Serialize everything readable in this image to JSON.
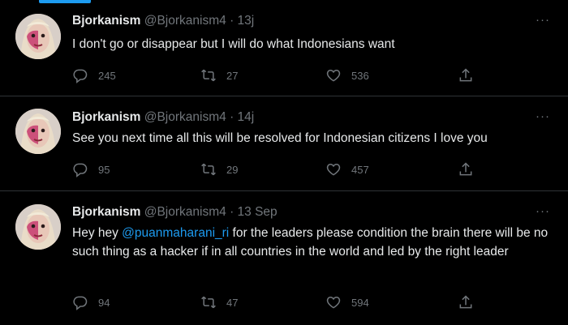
{
  "tweets": [
    {
      "name": "Bjorkanism",
      "handle": "@Bjorkanism4",
      "time": "13j",
      "text_before": "I don't go or disappear but I will do what Indonesians want",
      "mention": "",
      "text_after": "",
      "replies": "245",
      "retweets": "27",
      "likes": "536"
    },
    {
      "name": "Bjorkanism",
      "handle": "@Bjorkanism4",
      "time": "14j",
      "text_before": "See you next time all this will be resolved for Indonesian citizens I love you",
      "mention": "",
      "text_after": "",
      "replies": "95",
      "retweets": "29",
      "likes": "457"
    },
    {
      "name": "Bjorkanism",
      "handle": "@Bjorkanism4",
      "time": "13 Sep",
      "text_before": "Hey hey ",
      "mention": "@puanmaharani_ri",
      "text_after": " for the leaders please condition the brain there will be no such thing as a hacker if in all countries in the world and led by the right leader",
      "replies": "94",
      "retweets": "47",
      "likes": "594"
    }
  ],
  "separator": "·",
  "more_glyph": "···",
  "icons": [
    "reply-icon",
    "retweet-icon",
    "like-icon",
    "share-icon",
    "more-icon"
  ],
  "colors": {
    "background": "#000000",
    "text": "#e7e9ea",
    "muted": "#71767b",
    "accent": "#1d9bf0",
    "border": "#2f3336"
  }
}
